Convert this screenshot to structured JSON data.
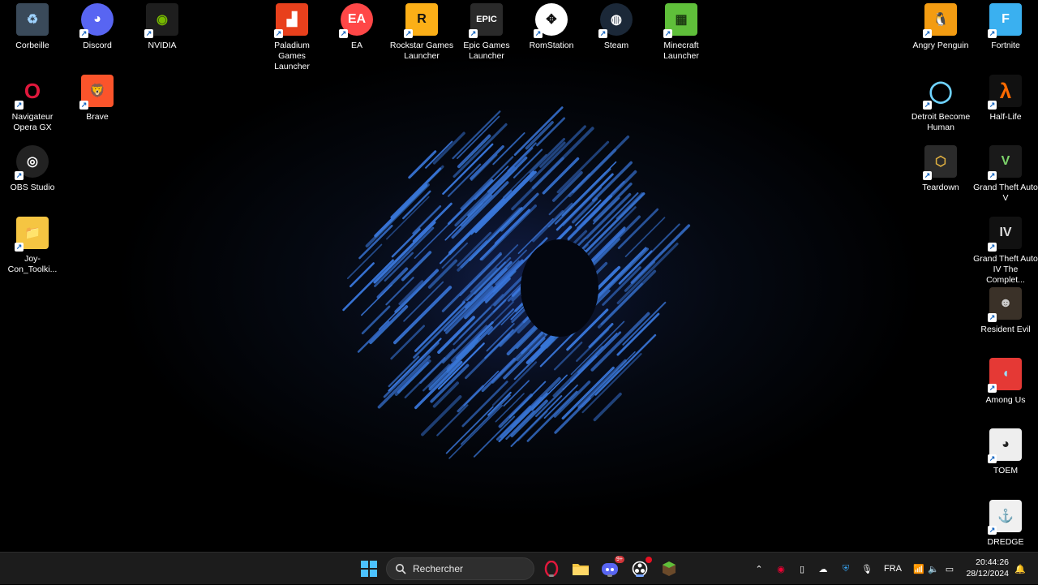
{
  "desktop": {
    "icons": [
      {
        "label": "Corbeille",
        "glyph": "♻",
        "icon": "recycle-bin-icon"
      },
      {
        "label": "Discord",
        "glyph": "◕",
        "icon": "discord-icon"
      },
      {
        "label": "NVIDIA",
        "glyph": "◉",
        "icon": "nvidia-icon"
      },
      {
        "label": "Paladium Games Launcher",
        "glyph": "▟",
        "icon": "paladium-icon"
      },
      {
        "label": "EA",
        "glyph": "EA",
        "icon": "ea-icon"
      },
      {
        "label": "Rockstar Games Launcher",
        "glyph": "R",
        "icon": "rockstar-icon"
      },
      {
        "label": "Epic Games Launcher",
        "glyph": "EPIC",
        "icon": "epic-games-icon"
      },
      {
        "label": "RomStation",
        "glyph": "✥",
        "icon": "romstation-icon"
      },
      {
        "label": "Steam",
        "glyph": "◍",
        "icon": "steam-icon"
      },
      {
        "label": "Minecraft Launcher",
        "glyph": "▦",
        "icon": "minecraft-icon"
      },
      {
        "label": "Angry Penguin",
        "glyph": "🐧",
        "icon": "penguin-icon"
      },
      {
        "label": "Fortnite",
        "glyph": "F",
        "icon": "fortnite-icon"
      },
      {
        "label": "Navigateur Opera GX",
        "glyph": "O",
        "icon": "opera-gx-icon"
      },
      {
        "label": "Brave",
        "glyph": "🦁",
        "icon": "brave-icon"
      },
      {
        "label": "OBS Studio",
        "glyph": "◎",
        "icon": "obs-icon"
      },
      {
        "label": "Joy-Con_Toolki...",
        "glyph": "📁",
        "icon": "folder-icon"
      },
      {
        "label": "Detroit Become Human",
        "glyph": "◯",
        "icon": "detroit-icon"
      },
      {
        "label": "Half-Life",
        "glyph": "λ",
        "icon": "half-life-icon"
      },
      {
        "label": "Teardown",
        "glyph": "⬡",
        "icon": "teardown-icon"
      },
      {
        "label": "Grand Theft Auto V",
        "glyph": "V",
        "icon": "gta-v-icon"
      },
      {
        "label": "Grand Theft Auto IV The Complet...",
        "glyph": "IV",
        "icon": "gta-iv-icon"
      },
      {
        "label": "Resident Evil",
        "glyph": "☻",
        "icon": "resident-evil-icon"
      },
      {
        "label": "Among Us",
        "glyph": "◖",
        "icon": "among-us-icon"
      },
      {
        "label": "TOEM",
        "glyph": "◕",
        "icon": "toem-icon"
      },
      {
        "label": "DREDGE",
        "glyph": "⚓",
        "icon": "dredge-icon"
      }
    ]
  },
  "taskbar": {
    "search_placeholder": "Rechercher",
    "discord_badge": "9+",
    "language": "FRA",
    "time": "20:44:26",
    "date": "28/12/2024"
  },
  "colors": {
    "taskbar": "#1c1c1c",
    "accent": "#7aa7ff"
  }
}
